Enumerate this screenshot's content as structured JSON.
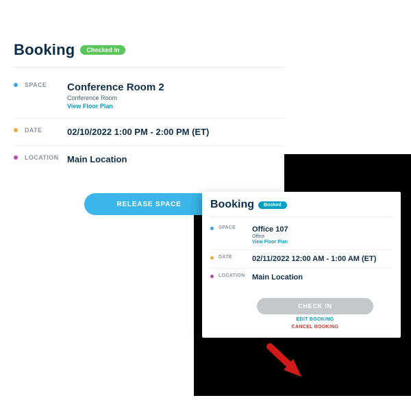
{
  "panelA": {
    "title": "Booking",
    "badge": "Checked In",
    "space": {
      "label": "SPACE",
      "name": "Conference Room 2",
      "type": "Conference Room",
      "floorplan_link": "View Floor Plan"
    },
    "date": {
      "label": "DATE",
      "value": "02/10/2022 1:00 PM - 2:00 PM (ET)"
    },
    "location": {
      "label": "LOCATION",
      "value": "Main Location"
    },
    "release_button": "RELEASE SPACE"
  },
  "panelB": {
    "title": "Booking",
    "badge": "Booked",
    "space": {
      "label": "SPACE",
      "name": "Office 107",
      "type": "Office",
      "floorplan_link": "View Floor Plan"
    },
    "date": {
      "label": "DATE",
      "value": "02/11/2022 12:00 AM - 1:00 AM (ET)"
    },
    "location": {
      "label": "LOCATION",
      "value": "Main Location"
    },
    "checkin_button": "CHECK IN",
    "edit_link": "EDIT BOOKING",
    "cancel_link": "CANCEL BOOKING"
  },
  "colors": {
    "dot_blue": "#3aa4e8",
    "dot_orange": "#f0a83a",
    "dot_magenta": "#b848b8",
    "badge_green": "#5bc65b",
    "badge_teal": "#009dc4",
    "btn_blue": "#3bb5ea",
    "btn_gray": "#c5c8cb",
    "danger": "#cc3a2a"
  }
}
